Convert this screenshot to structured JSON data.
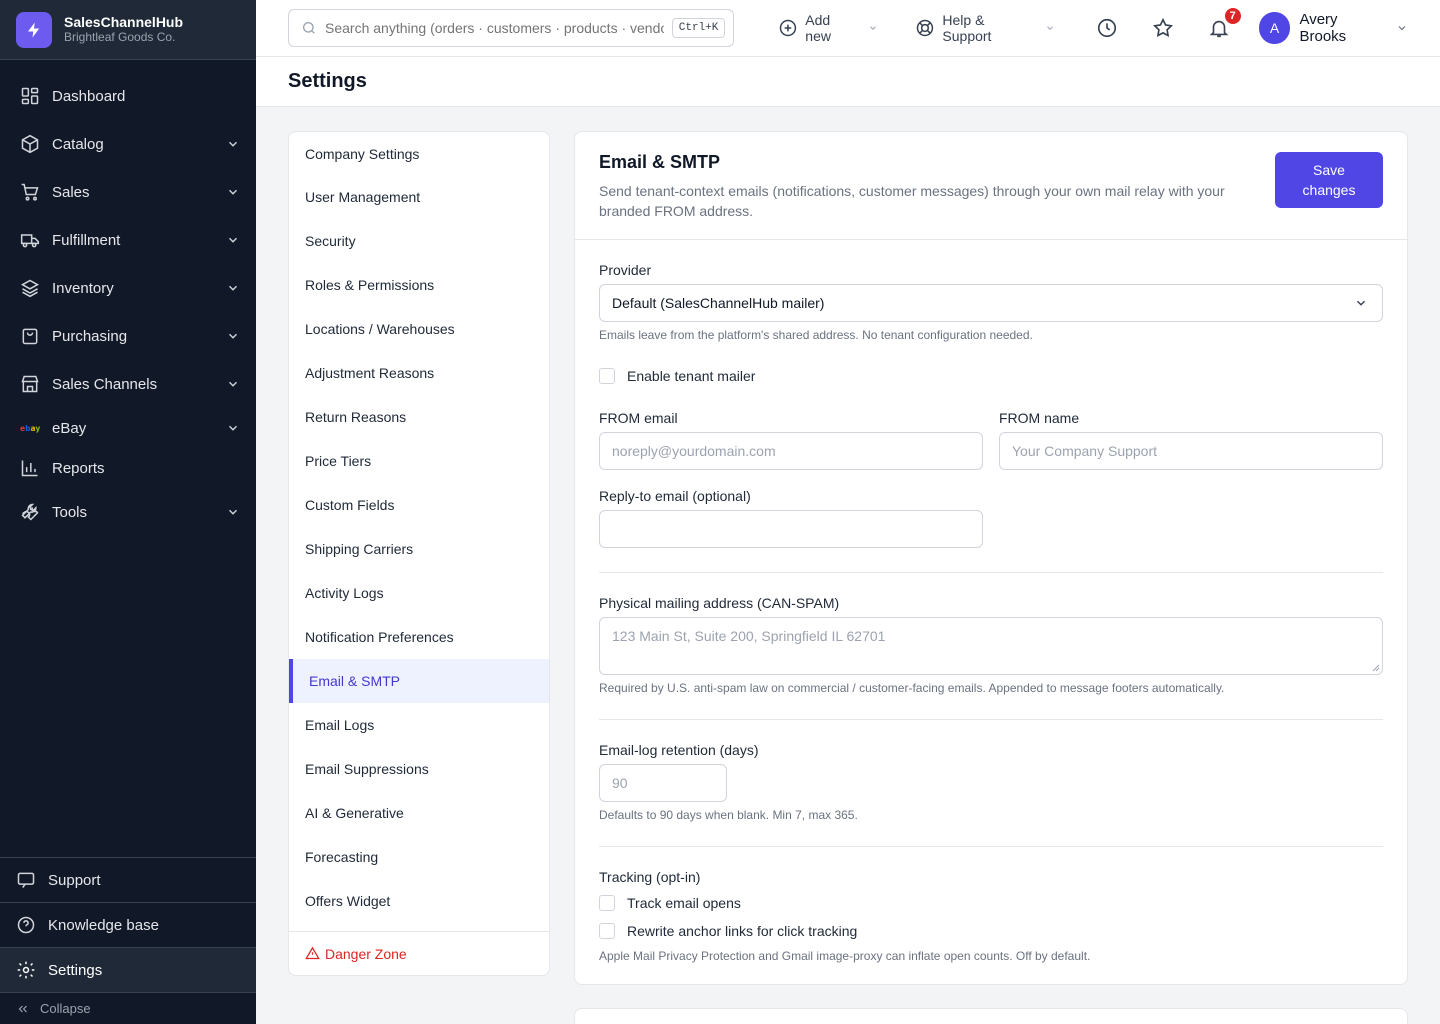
{
  "brand": {
    "name": "SalesChannelHub",
    "company": "Brightleaf Goods Co."
  },
  "sidebar": {
    "items": [
      {
        "label": "Dashboard",
        "icon": "dashboard-icon",
        "expandable": false
      },
      {
        "label": "Catalog",
        "icon": "box-icon",
        "expandable": true
      },
      {
        "label": "Sales",
        "icon": "cart-icon",
        "expandable": true
      },
      {
        "label": "Fulfillment",
        "icon": "truck-icon",
        "expandable": true
      },
      {
        "label": "Inventory",
        "icon": "layers-icon",
        "expandable": true
      },
      {
        "label": "Purchasing",
        "icon": "bag-icon",
        "expandable": true
      },
      {
        "label": "Sales Channels",
        "icon": "store-icon",
        "expandable": true
      },
      {
        "label": "eBay",
        "icon": "ebay-logo",
        "expandable": true
      },
      {
        "label": "Reports",
        "icon": "bar-chart-icon",
        "expandable": false
      },
      {
        "label": "Tools",
        "icon": "wrench-icon",
        "expandable": true
      }
    ],
    "bottom": {
      "support": "Support",
      "knowledge_base": "Knowledge base",
      "settings": "Settings",
      "collapse": "Collapse"
    }
  },
  "topbar": {
    "search_placeholder": "Search anything (orders · customers · products · vendors)",
    "search_shortcut": "Ctrl+K",
    "add_new": "Add new",
    "help": "Help & Support",
    "notifications_count": "7",
    "user_initial": "A",
    "user_name": "Avery Brooks"
  },
  "page": {
    "title": "Settings"
  },
  "settings_nav": {
    "items": [
      "Company Settings",
      "User Management",
      "Security",
      "Roles & Permissions",
      "Locations / Warehouses",
      "Adjustment Reasons",
      "Return Reasons",
      "Price Tiers",
      "Custom Fields",
      "Shipping Carriers",
      "Activity Logs",
      "Notification Preferences",
      "Email & SMTP",
      "Email Logs",
      "Email Suppressions",
      "AI & Generative",
      "Forecasting",
      "Offers Widget"
    ],
    "active": "Email & SMTP",
    "danger": "Danger Zone"
  },
  "email": {
    "title": "Email & SMTP",
    "description": "Send tenant-context emails (notifications, customer messages) through your own mail relay with your branded FROM address.",
    "save_label": "Save changes",
    "provider_label": "Provider",
    "provider_value": "Default (SalesChannelHub mailer)",
    "provider_help": "Emails leave from the platform's shared address. No tenant configuration needed.",
    "enable_label": "Enable tenant mailer",
    "from_email_label": "FROM email",
    "from_email_placeholder": "noreply@yourdomain.com",
    "from_name_label": "FROM name",
    "from_name_placeholder": "Your Company Support",
    "reply_to_label": "Reply-to email (optional)",
    "reply_to_value": "",
    "address_label": "Physical mailing address (CAN-SPAM)",
    "address_placeholder": "123 Main St, Suite 200, Springfield IL 62701",
    "address_help": "Required by U.S. anti-spam law on commercial / customer-facing emails. Appended to message footers automatically.",
    "retention_label": "Email-log retention (days)",
    "retention_placeholder": "90",
    "retention_help": "Defaults to 90 days when blank. Min 7, max 365.",
    "tracking_label": "Tracking (opt-in)",
    "track_opens_label": "Track email opens",
    "rewrite_links_label": "Rewrite anchor links for click tracking",
    "tracking_help": "Apple Mail Privacy Protection and Gmail image-proxy can inflate open counts. Off by default."
  },
  "colors": {
    "accent": "#4f46e5",
    "sidebar_bg": "#111827",
    "danger": "#dc2626",
    "badge": "#dc2626"
  }
}
